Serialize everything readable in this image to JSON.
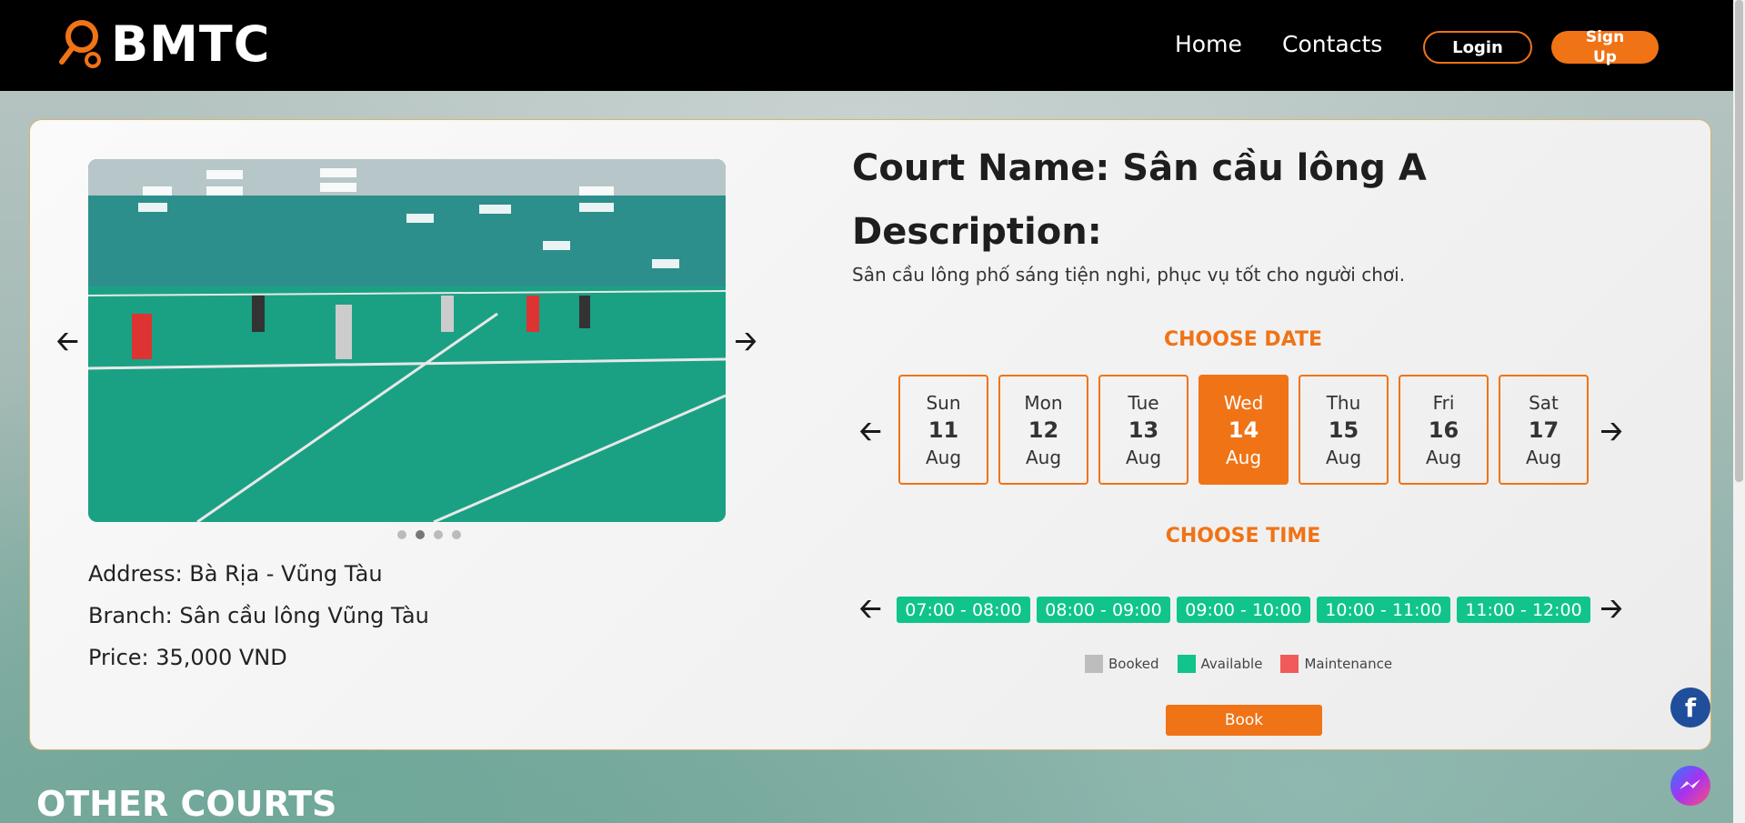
{
  "header": {
    "brand": "BMTC",
    "nav": [
      "Home",
      "Contacts"
    ],
    "login_label": "Login",
    "signup_label": "Sign Up"
  },
  "court": {
    "title": "Court Name: Sân cầu lông A",
    "description_heading": "Description:",
    "description": "Sân cầu lông phố sáng tiện nghi, phục vụ tốt cho người chơi.",
    "address": "Address: Bà Rịa - Vũng Tàu",
    "branch": "Branch: Sân cầu lông Vũng Tàu",
    "price": "Price: 35,000 VND"
  },
  "carousel": {
    "slide_count": 4,
    "active_slide": 2
  },
  "choose_date": {
    "label": "CHOOSE DATE",
    "dates": [
      {
        "dow": "Sun",
        "day": "11",
        "month": "Aug"
      },
      {
        "dow": "Mon",
        "day": "12",
        "month": "Aug"
      },
      {
        "dow": "Tue",
        "day": "13",
        "month": "Aug"
      },
      {
        "dow": "Wed",
        "day": "14",
        "month": "Aug"
      },
      {
        "dow": "Thu",
        "day": "15",
        "month": "Aug"
      },
      {
        "dow": "Fri",
        "day": "16",
        "month": "Aug"
      },
      {
        "dow": "Sat",
        "day": "17",
        "month": "Aug"
      }
    ],
    "selected_index": 3
  },
  "choose_time": {
    "label": "CHOOSE TIME",
    "slots": [
      "07:00 - 08:00",
      "08:00 - 09:00",
      "09:00 - 10:00",
      "10:00 - 11:00",
      "11:00 - 12:00"
    ]
  },
  "legend": [
    {
      "label": "Booked",
      "color": "#bdbdbd"
    },
    {
      "label": "Available",
      "color": "#10c48b"
    },
    {
      "label": "Maintenance",
      "color": "#f05a5a"
    }
  ],
  "book_label": "Book",
  "other_courts_heading": "OTHER COURTS",
  "colors": {
    "accent": "#f07316",
    "available": "#10c48b",
    "facebook": "#1f4e9a",
    "messenger": "#8a3cf0"
  },
  "icons": {
    "brand": "racket-logo-icon",
    "prev": "arrow-left-icon",
    "next": "arrow-right-icon",
    "facebook": "facebook-icon",
    "messenger": "messenger-icon"
  }
}
